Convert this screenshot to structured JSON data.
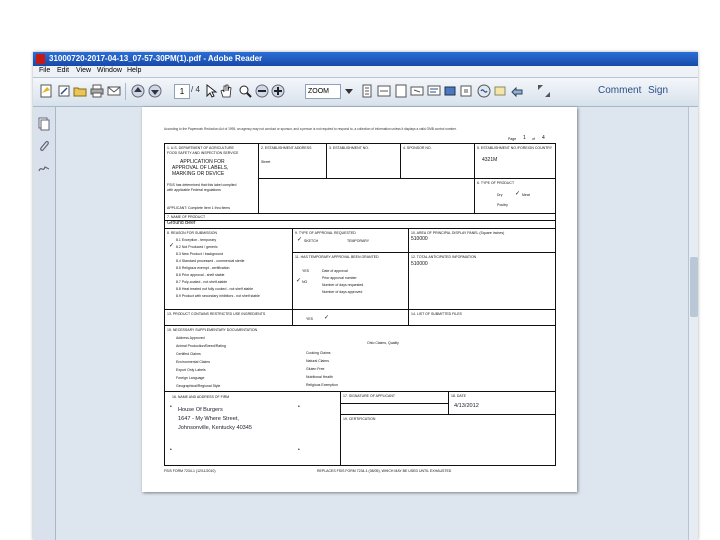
{
  "window": {
    "title": "31000720-2017-04-13_07-57-30PM(1).pdf - Adobe Reader",
    "menu": [
      "File",
      "Edit",
      "View",
      "Window",
      "Help"
    ]
  },
  "toolbar": {
    "page_current": "1",
    "page_total": "/ 4",
    "zoom": "ZOOM",
    "comment": "Comment",
    "sign": "Sign"
  },
  "document": {
    "header_text": "According to the Paperwork Reduction Act of 1995, an agency may not conduct or sponsor, and a person is not required to respond to, a collection of information unless it displays a valid OMB control number.",
    "page_label": "Page",
    "page_num": "1",
    "page_of": "of",
    "page_total": "4",
    "box1": {
      "label": "1. U.S. DEPARTMENT OF AGRICULTURE",
      "sub": "FOOD SAFETY AND INSPECTION SERVICE",
      "title1": "APPLICATION FOR",
      "title2": "APPROVAL OF LABELS,",
      "title3": "MARKING OR DEVICE",
      "note1": "FSIS has determined that this label complied",
      "note2": "with applicable Federal regulations",
      "applicant": "APPLICANT: Complete Item 1 thru items"
    },
    "box2": {
      "label": "2. ESTABLISHMENT ADDRESS",
      "val": "Street"
    },
    "box3": {
      "label": "3. ESTABLISHMENT NO."
    },
    "box4": {
      "label": "4. SPONSOR NO."
    },
    "box5": {
      "label": "5. ESTABLISHMENT NO./FOREIGN COUNTRY",
      "val": "4321M"
    },
    "box6": {
      "label": "6. TYPE OF PRODUCT",
      "dry": "Dry",
      "meat": "Meat",
      "poultry": "Poultry"
    },
    "box7": {
      "label": "7. NAME OF PRODUCT",
      "val": "Ground Beef"
    },
    "box8": {
      "label": "8. REASON FOR SUBMISSION",
      "items": [
        "8.1 Exception - temporary",
        "8.2 Not Produced / generic",
        "8.3 New Product / background",
        "8.4 Standard processed - commercial sterile",
        "8.5 Religious exempt - certification",
        "8.6 Prior approval - shelf stable",
        "8.7 Poly-coated - not shelf-stable",
        "8.8 Heat treated not fully cooked - not shelf stable",
        "8.9 Product with secondary inhibitors - not shelf stable"
      ]
    },
    "box9": {
      "label": "9. TYPE OF APPROVAL REQUESTED",
      "sketch": "SKETCH",
      "temporary": "TEMPORARY"
    },
    "box10": {
      "label": "10. AREA OF PRINCIPAL DISPLAY PANEL (Square Inches)",
      "val": "510000"
    },
    "box11": {
      "label": "11. HAS TEMPORARY APPROVAL BEEN GRANTED",
      "yes": "YES",
      "no": "NO",
      "lines": [
        "Date of approval",
        "Prior approval number",
        "Number of days requested",
        "Number of days approved"
      ]
    },
    "box12": {
      "label": "12. TOTAL ANTICIPATED INFORMATION",
      "val": "510000"
    },
    "box13": {
      "label": "13. PRODUCT CONTAINS RESTRICTED USE INGREDIENTS",
      "yes": "YES"
    },
    "box14": {
      "label": "14. LIST OF SUBMITTED FILES"
    },
    "box15": {
      "label": "15. NECESSARY SUPPLEMENTARY DOCUMENTATION",
      "items": [
        "Address Approved",
        "Animal Production/Breed/Rating",
        "Certified Claims",
        "Environmental Claims",
        "Export Only Labels",
        "Foreign Language",
        "Geographical/Regional Style"
      ],
      "items2": [
        "Cooking Claims",
        "Natural Claims",
        "Gluten Free",
        "Nutritional Health",
        "Religious Exemption"
      ],
      "right": "Ohio Claims, Quality"
    },
    "box16": {
      "label": "16. NAME AND ADDRESS OF FIRM",
      "name": "House Of Burgers",
      "street": "1647 - My Where Street,",
      "city": "Johnsonville, Kentucky 40345"
    },
    "box17": {
      "label": "17. SIGNATURE OF APPLICANT"
    },
    "box18": {
      "label": "18. DATE",
      "val": "4/13/2012"
    },
    "box19": {
      "label": "19. CERTIFICATION"
    },
    "footer_left": "FSIS FORM 7234-1 (12/11/2010)",
    "footer_right": "REPLACES FSIS FORM 7234-1 (08/05), WHICH MAY BE USED UNTIL EXHAUSTED"
  }
}
